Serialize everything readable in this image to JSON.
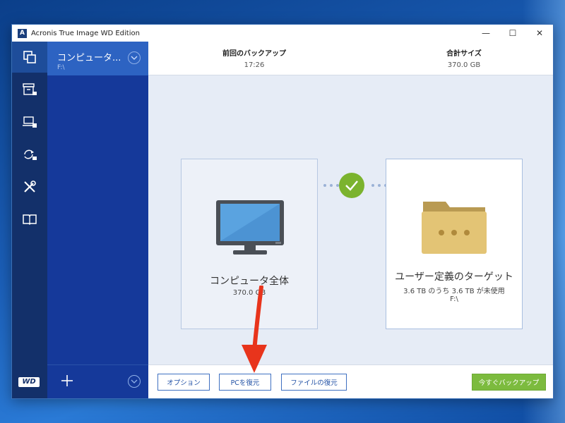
{
  "window": {
    "title": "Acronis True Image WD Edition",
    "icon_letter": "A"
  },
  "window_controls": {
    "minimize": "—",
    "maximize": "☐",
    "close": "✕"
  },
  "rail": {
    "items": [
      {
        "icon": "copy-icon",
        "active": true
      },
      {
        "icon": "archive-lock-icon",
        "active": false
      },
      {
        "icon": "laptop-lock-icon",
        "active": false
      },
      {
        "icon": "sync-lock-icon",
        "active": false
      },
      {
        "icon": "tools-icon",
        "active": false
      },
      {
        "icon": "book-icon",
        "active": false
      }
    ],
    "logo": "WD"
  },
  "backup_list": {
    "selected": {
      "name": "コンピュータ...",
      "location": "F:\\"
    }
  },
  "info": {
    "last_backup_label": "前回のバックアップ",
    "last_backup_value": "17:26",
    "total_size_label": "合計サイズ",
    "total_size_value": "370.0 GB"
  },
  "source": {
    "title": "コンピュータ全体",
    "size": "370.0 GB"
  },
  "target": {
    "title": "ユーザー定義のターゲット",
    "free": "3.6 TB のうち 3.6 TB が未使用",
    "path": "F:\\"
  },
  "buttons": {
    "options": "オプション",
    "restore_pc": "PCを復元",
    "restore_files": "ファイルの復元",
    "backup_now": "今すぐバックアップ"
  },
  "colors": {
    "accent": "#2453a6",
    "rail": "#13306a",
    "list": "#15399a",
    "success": "#7bb32e",
    "annotation": "#e8341c"
  }
}
